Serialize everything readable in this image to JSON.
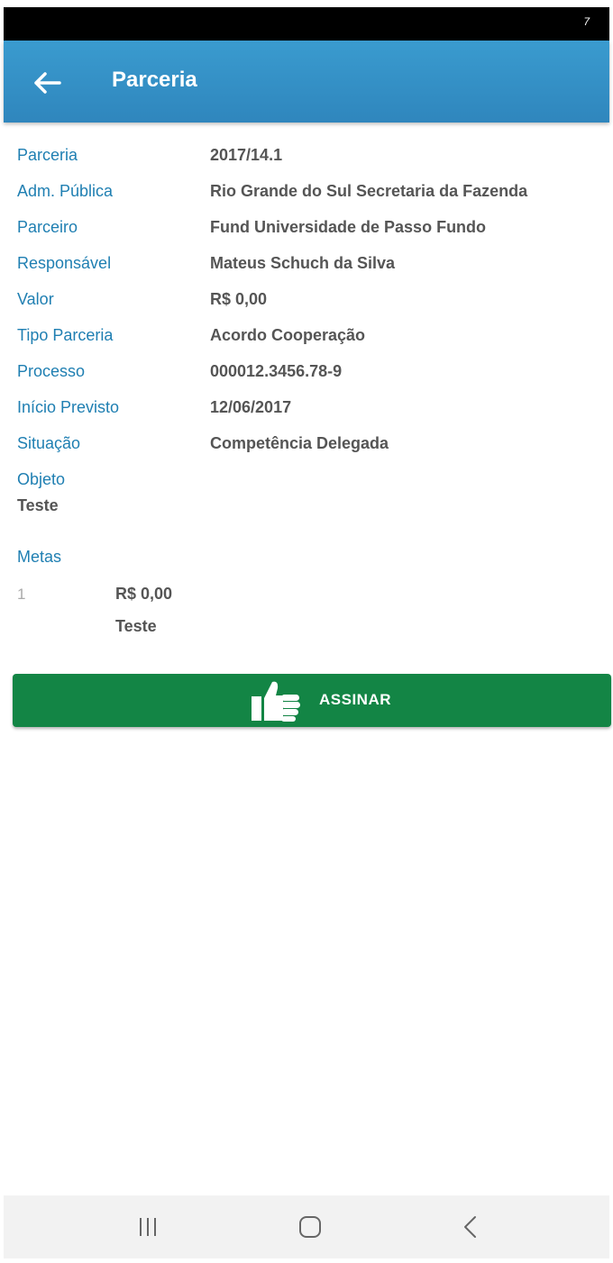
{
  "status_bar": {
    "indicator": "7"
  },
  "app_bar": {
    "title": "Parceria"
  },
  "fields": [
    {
      "label": "Parceria",
      "value": "2017/14.1"
    },
    {
      "label": "Adm. Pública",
      "value": "Rio Grande do Sul Secretaria da Fazenda"
    },
    {
      "label": "Parceiro",
      "value": "Fund Universidade de Passo Fundo"
    },
    {
      "label": "Responsável",
      "value": "Mateus Schuch da Silva"
    },
    {
      "label": "Valor",
      "value": "R$ 0,00"
    },
    {
      "label": "Tipo Parceria",
      "value": "Acordo Cooperação"
    },
    {
      "label": "Processo",
      "value": "000012.3456.78-9"
    },
    {
      "label": "Início Previsto",
      "value": "12/06/2017"
    },
    {
      "label": "Situação",
      "value": "Competência Delegada"
    }
  ],
  "objeto": {
    "label": "Objeto",
    "value": "Teste"
  },
  "metas": {
    "label": "Metas",
    "items": [
      {
        "index": "1",
        "value": "R$ 0,00",
        "description": "Teste"
      }
    ]
  },
  "sign_button": {
    "label": "ASSINAR"
  },
  "icons": {
    "back": "arrow-left-icon",
    "sign": "thumbs-up-icon",
    "nav_recent": "recent-apps-icon",
    "nav_home": "home-icon",
    "nav_back": "chevron-left-icon"
  },
  "colors": {
    "app_bar": "#3a9bcf",
    "label": "#1f7fb2",
    "value": "#555555",
    "sign_button": "#138545"
  }
}
